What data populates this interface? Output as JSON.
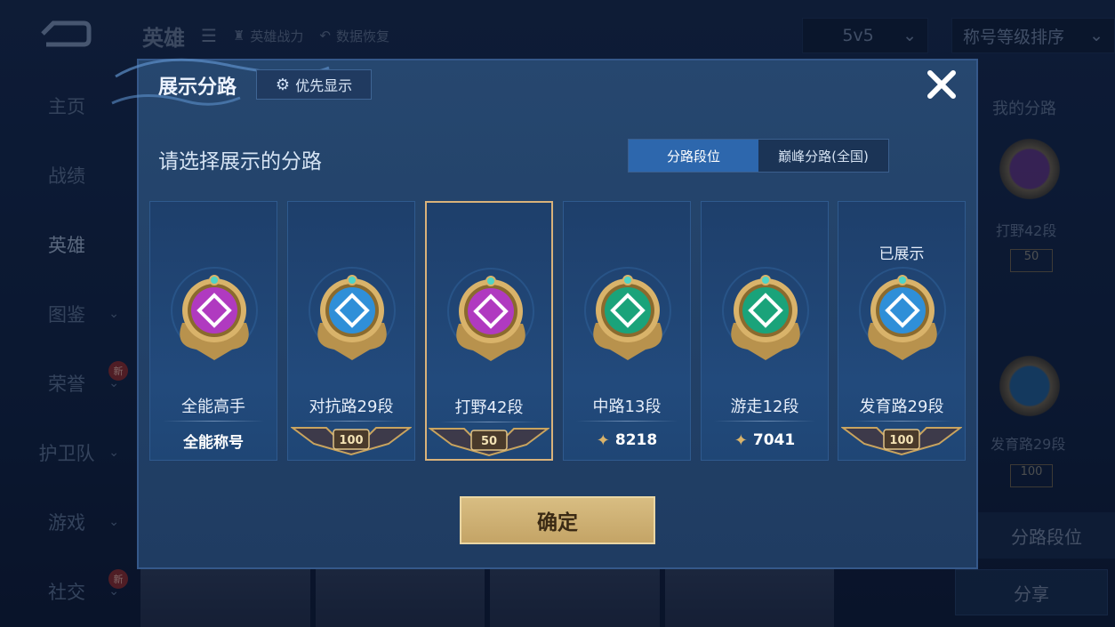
{
  "background": {
    "title": "英雄",
    "tabs": [
      "英雄战力",
      "数据恢复"
    ],
    "mode_dropdown": "5v5",
    "sort_dropdown": "称号等级排序",
    "sidebar": [
      {
        "label": "主页",
        "new": false
      },
      {
        "label": "战绩",
        "new": false
      },
      {
        "label": "英雄",
        "new": false,
        "active": true
      },
      {
        "label": "图鉴",
        "new": false,
        "chevron": true
      },
      {
        "label": "荣誉",
        "new": true,
        "chevron": true
      },
      {
        "label": "护卫队",
        "new": false,
        "chevron": true
      },
      {
        "label": "游戏",
        "new": false,
        "chevron": true
      },
      {
        "label": "社交",
        "new": true,
        "chevron": true
      }
    ],
    "new_badge": "新",
    "right_panel": {
      "header": "我的分路",
      "item1": "打野42段",
      "item1_level": "50",
      "item2": "发育路29段",
      "item2_level": "100",
      "lane_button": "分路段位",
      "share_button": "分享"
    }
  },
  "modal": {
    "title": "展示分路",
    "priority_button": "优先显示",
    "subtitle": "请选择展示的分路",
    "segment": {
      "active": "分路段位",
      "inactive": "巅峰分路(全国)"
    },
    "cards": [
      {
        "name": "全能高手",
        "footer_text": "全能称号",
        "footer_type": "text",
        "color": "#b03ac0",
        "selected": false,
        "shown": ""
      },
      {
        "name": "对抗路29段",
        "footer_text": "100",
        "footer_type": "plaque",
        "color": "#2f8fd8",
        "selected": false,
        "shown": ""
      },
      {
        "name": "打野42段",
        "footer_text": "50",
        "footer_type": "plaque",
        "color": "#b03ac0",
        "selected": true,
        "shown": ""
      },
      {
        "name": "中路13段",
        "footer_text": "8218",
        "footer_type": "score",
        "color": "#1aa37a",
        "selected": false,
        "shown": ""
      },
      {
        "name": "游走12段",
        "footer_text": "7041",
        "footer_type": "score",
        "color": "#1aa37a",
        "selected": false,
        "shown": ""
      },
      {
        "name": "发育路29段",
        "footer_text": "100",
        "footer_type": "plaque",
        "color": "#2f8fd8",
        "selected": false,
        "shown": "已展示"
      }
    ],
    "confirm_button": "确定"
  },
  "colors": {
    "gold": "#d8bd82",
    "accent_blue": "#2d67ad",
    "panel": "#1f3c62"
  }
}
